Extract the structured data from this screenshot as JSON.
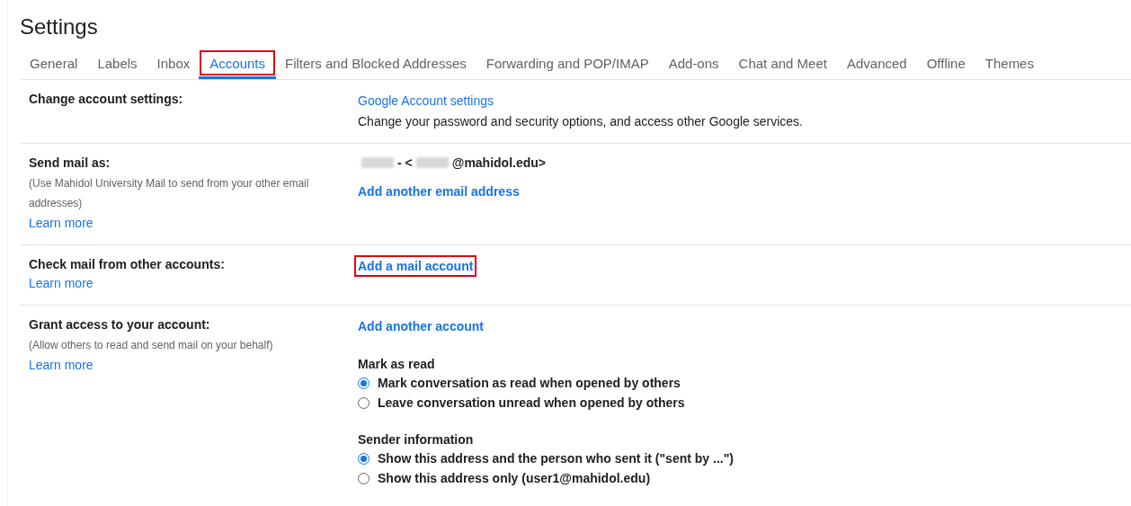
{
  "title": "Settings",
  "tabs": [
    {
      "label": "General",
      "selected": false,
      "highlighted": false
    },
    {
      "label": "Labels",
      "selected": false,
      "highlighted": false
    },
    {
      "label": "Inbox",
      "selected": false,
      "highlighted": false
    },
    {
      "label": "Accounts",
      "selected": true,
      "highlighted": true
    },
    {
      "label": "Filters and Blocked Addresses",
      "selected": false,
      "highlighted": false
    },
    {
      "label": "Forwarding and POP/IMAP",
      "selected": false,
      "highlighted": false
    },
    {
      "label": "Add-ons",
      "selected": false,
      "highlighted": false
    },
    {
      "label": "Chat and Meet",
      "selected": false,
      "highlighted": false
    },
    {
      "label": "Advanced",
      "selected": false,
      "highlighted": false
    },
    {
      "label": "Offline",
      "selected": false,
      "highlighted": false
    },
    {
      "label": "Themes",
      "selected": false,
      "highlighted": false
    }
  ],
  "sections": [
    {
      "label": "Change account settings:",
      "content": [
        {
          "kind": "link",
          "text": "Google Account settings",
          "bold": false,
          "highlighted": false
        },
        {
          "kind": "text",
          "text": "Change your password and security options, and access other Google services."
        }
      ]
    },
    {
      "label": "Send mail as:",
      "note": "(Use Mahidol University Mail to send from your other email addresses)",
      "learn_more": "Learn more",
      "content": [
        {
          "kind": "address",
          "parts": [
            "-  <",
            "@mahidol.edu>"
          ]
        },
        {
          "kind": "link",
          "text": "Add another email address",
          "bold": true,
          "highlighted": false
        }
      ]
    },
    {
      "label": "Check mail from other accounts:",
      "learn_more": "Learn more",
      "content": [
        {
          "kind": "link",
          "text": "Add a mail account",
          "bold": true,
          "highlighted": true
        }
      ]
    },
    {
      "label": "Grant access to your account:",
      "note": "(Allow others to read and send mail on your behalf)",
      "learn_more": "Learn more",
      "content": [
        {
          "kind": "link",
          "text": "Add another account",
          "bold": true,
          "highlighted": false
        },
        {
          "kind": "radios",
          "heading": "Mark as read",
          "options": [
            {
              "label": "Mark conversation as read when opened by others",
              "selected": true
            },
            {
              "label": "Leave conversation unread when opened by others",
              "selected": false
            }
          ]
        },
        {
          "kind": "radios",
          "heading": "Sender information",
          "options": [
            {
              "label": "Show this address and the person who sent it (\"sent by ...\")",
              "selected": true
            },
            {
              "label": "Show this address only (user1@mahidol.edu)",
              "selected": false
            }
          ]
        }
      ]
    }
  ]
}
